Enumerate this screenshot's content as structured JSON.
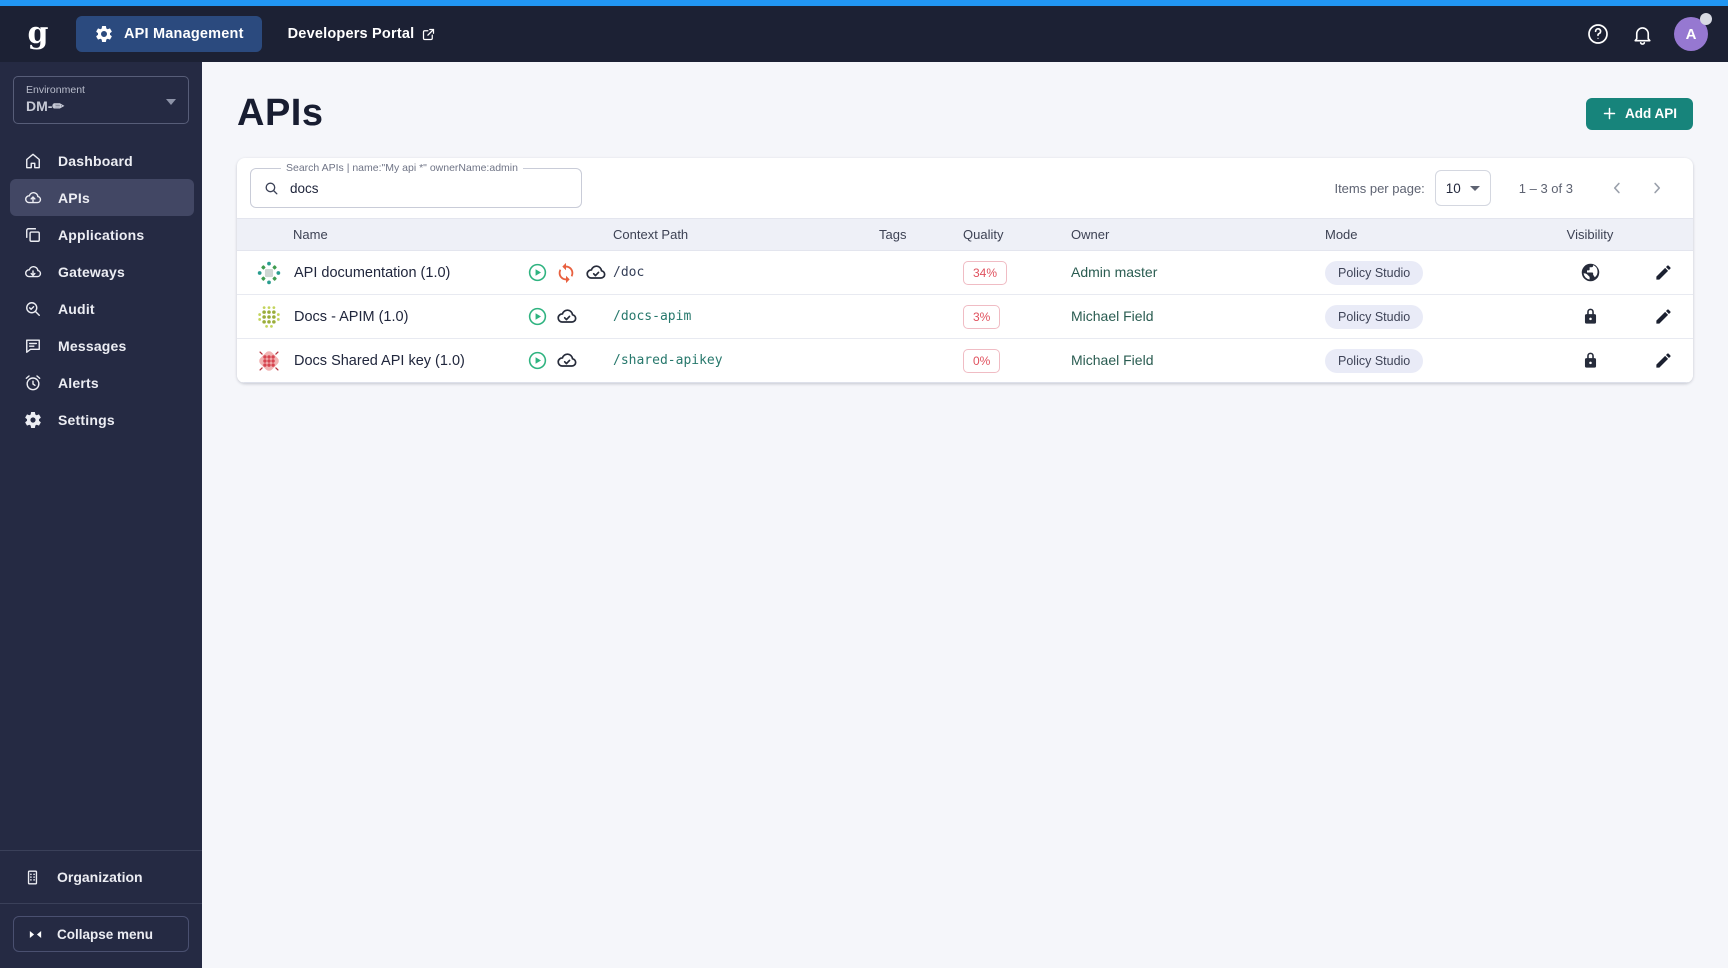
{
  "colors": {
    "accent_blue": "#2196F3",
    "topbar_bg": "#1C2134",
    "sidebar_bg": "#252A43",
    "sidebar_active_bg": "#424764",
    "teal_button": "#17847B",
    "quality_red": "#E0515E",
    "owner_link_green": "#2A5C51",
    "context_path_teal": "#27786C",
    "avatar_purple": "#9678D1",
    "status_started_green": "#2FB380",
    "status_out_of_sync_orange": "#E8603F"
  },
  "topbar": {
    "logo_letter": "g",
    "api_management_label": "API Management",
    "developers_portal_label": "Developers Portal",
    "avatar_letter": "A"
  },
  "sidebar": {
    "environment_label": "Environment",
    "environment_value": "DM-✏",
    "items": [
      {
        "label": "Dashboard",
        "icon": "home-icon",
        "active": false
      },
      {
        "label": "APIs",
        "icon": "cloud-upload-icon",
        "active": true
      },
      {
        "label": "Applications",
        "icon": "applications-icon",
        "active": false
      },
      {
        "label": "Gateways",
        "icon": "cloud-download-icon",
        "active": false
      },
      {
        "label": "Audit",
        "icon": "audit-search-icon",
        "active": false
      },
      {
        "label": "Messages",
        "icon": "message-icon",
        "active": false
      },
      {
        "label": "Alerts",
        "icon": "alarm-icon",
        "active": false
      },
      {
        "label": "Settings",
        "icon": "gear-icon",
        "active": false
      }
    ],
    "organization_label": "Organization",
    "collapse_label": "Collapse menu"
  },
  "page": {
    "title": "APIs",
    "add_api_label": "Add API",
    "search_label": "Search APIs | name:\"My api *\" ownerName:admin",
    "search_value": "docs",
    "items_per_page_label": "Items per page:",
    "items_per_page_value": "10",
    "range_label": "1 – 3 of 3"
  },
  "table": {
    "headers": {
      "name": "Name",
      "context_path": "Context Path",
      "tags": "Tags",
      "quality": "Quality",
      "owner": "Owner",
      "mode": "Mode",
      "visibility": "Visibility"
    },
    "rows": [
      {
        "name": "API documentation (1.0)",
        "status_icons": [
          "started",
          "out-of-sync",
          "deployed"
        ],
        "context_path": "/doc",
        "tags": "",
        "quality": "34%",
        "owner": "Admin master",
        "mode": "Policy Studio",
        "visibility": "public"
      },
      {
        "name": "Docs - APIM (1.0)",
        "status_icons": [
          "started",
          "deployed"
        ],
        "context_path": "/docs-apim",
        "tags": "",
        "quality": "3%",
        "owner": "Michael Field",
        "mode": "Policy Studio",
        "visibility": "private"
      },
      {
        "name": "Docs Shared API key (1.0)",
        "status_icons": [
          "started",
          "deployed"
        ],
        "context_path": "/shared-apikey",
        "tags": "",
        "quality": "0%",
        "owner": "Michael Field",
        "mode": "Policy Studio",
        "visibility": "private"
      }
    ]
  }
}
